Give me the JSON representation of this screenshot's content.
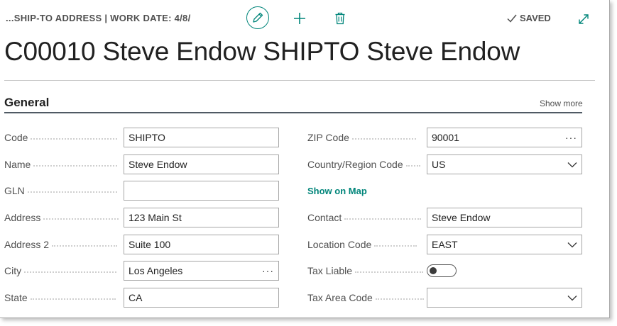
{
  "header": {
    "breadcrumb": "...SHIP-TO ADDRESS | WORK DATE: 4/8/",
    "saved_label": "SAVED"
  },
  "page": {
    "title": "C00010 Steve Endow SHIPTO Steve Endow"
  },
  "section": {
    "title": "General",
    "show_more": "Show more"
  },
  "left_fields": [
    {
      "label": "Code",
      "value": "SHIPTO"
    },
    {
      "label": "Name",
      "value": "Steve Endow"
    },
    {
      "label": "GLN",
      "value": ""
    },
    {
      "label": "Address",
      "value": "123 Main St"
    },
    {
      "label": "Address 2",
      "value": "Suite 100"
    },
    {
      "label": "City",
      "value": "Los Angeles"
    },
    {
      "label": "State",
      "value": "CA"
    }
  ],
  "right_fields": {
    "zip": {
      "label": "ZIP Code",
      "value": "90001"
    },
    "country": {
      "label": "Country/Region Code",
      "value": "US"
    },
    "show_on_map": "Show on Map",
    "contact": {
      "label": "Contact",
      "value": "Steve Endow"
    },
    "location": {
      "label": "Location Code",
      "value": "EAST"
    },
    "tax_liable": {
      "label": "Tax Liable",
      "value": false
    },
    "tax_area": {
      "label": "Tax Area Code",
      "value": ""
    }
  },
  "icons": {
    "edit": "pencil-icon",
    "new": "plus-icon",
    "delete": "trash-icon",
    "saved": "check-icon",
    "expand": "expand-icon"
  },
  "colors": {
    "accent": "#00857a",
    "rule": "#505a64",
    "label": "#505050"
  }
}
